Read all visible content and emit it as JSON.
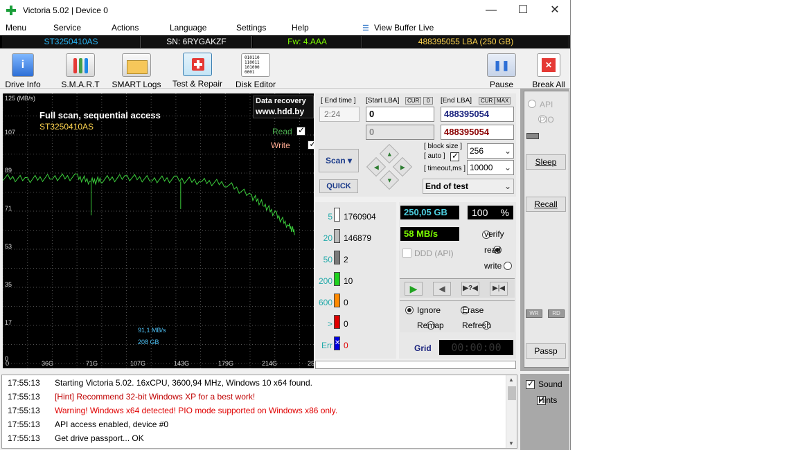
{
  "window": {
    "title": "Victoria 5.02 | Device 0",
    "min": "—",
    "max": "☐",
    "close": "✕"
  },
  "menu": [
    "Menu",
    "Service",
    "Actions",
    "Language",
    "Settings",
    "Help",
    "View Buffer Live"
  ],
  "infobar": {
    "model": "ST3250410AS",
    "serial": "SN: 6RYGAKZF",
    "firmware": "Fw: 4.AAA",
    "lba": "488395055 LBA (250 GB)"
  },
  "toolbar": {
    "drive_info": "Drive Info",
    "smart": "S.M.A.R.T",
    "smart_logs": "SMART Logs",
    "test_repair": "Test & Repair",
    "disk_editor": "Disk Editor",
    "pause": "Pause",
    "break_all": "Break All"
  },
  "graph": {
    "unit": "125 (MB/s)",
    "title": "Full scan, sequential access",
    "model": "ST3250410AS",
    "badge_line1": "Data recovery",
    "badge_line2": "www.hdd.by",
    "read_label": "Read",
    "write_label": "Write",
    "speed_readout": "91,1 MB/s",
    "pos_readout": "208 GB",
    "y_ticks": [
      "107",
      "89",
      "71",
      "53",
      "35",
      "17",
      "0"
    ],
    "x_ticks": [
      "36G",
      "71G",
      "107G",
      "143G",
      "179G",
      "214G",
      "25"
    ]
  },
  "chart_data": {
    "type": "line",
    "title": "Full scan, sequential access",
    "ylabel": "(MB/s)",
    "ylim": [
      0,
      125
    ],
    "x_label_ticks": [
      "0",
      "36G",
      "71G",
      "107G",
      "143G",
      "179G",
      "214G",
      "25"
    ],
    "series": [
      {
        "name": "Read",
        "x_gb": [
          0,
          20,
          40,
          60,
          71,
          80,
          100,
          120,
          140,
          160,
          180,
          200,
          210,
          220,
          230,
          235
        ],
        "values": [
          88,
          87,
          88,
          88,
          86,
          87,
          88,
          87,
          87,
          86,
          85,
          79,
          75,
          70,
          65,
          62
        ]
      }
    ]
  },
  "controls": {
    "end_time_label": "[ End time ]",
    "end_time": "2:24",
    "start_lba_label": "[Start LBA]",
    "cur": "CUR",
    "zero": "0",
    "end_lba_label": "[End LBA]",
    "max": "MAX",
    "start_lba": "0",
    "end_lba": "488395054",
    "start_lba2": "0",
    "end_lba2": "488395054",
    "scan": "Scan",
    "quick": "QUICK",
    "block_size_label": "[ block size ]",
    "auto_label": "[ auto ]",
    "block_size": "256",
    "timeout_label": "[ timeout,ms ]",
    "timeout": "10000",
    "end_action": "End of test"
  },
  "stats": [
    {
      "t": "5",
      "v": "1760904",
      "c": "#ffffff"
    },
    {
      "t": "20",
      "v": "146879",
      "c": "#bdbdbd"
    },
    {
      "t": "50",
      "v": "2",
      "c": "#7a7a7a"
    },
    {
      "t": "200",
      "v": "10",
      "c": "#1fd31f"
    },
    {
      "t": "600",
      "v": "0",
      "c": "#ff8a00"
    },
    {
      "t": ">",
      "v": "0",
      "c": "#e00000"
    },
    {
      "t": "Err",
      "v": "0",
      "c": "#0000e0"
    }
  ],
  "progress": {
    "size": "250,05 GB",
    "percent": "100",
    "pct_sign": "%",
    "speed": "58 MB/s",
    "ddd": "DDD (API)",
    "verify": "verify",
    "read": "read",
    "write": "write",
    "ignore": "Ignore",
    "erase": "Erase",
    "remap": "Remap",
    "refresh": "Refresh",
    "grid": "Grid",
    "timer": "00:00:00"
  },
  "side": {
    "api": "API",
    "pio": "PIO",
    "sleep": "Sleep",
    "recall": "Recall",
    "wr": "WR",
    "rd": "RD",
    "passp": "Passp",
    "sound": "Sound",
    "hints": "Hints"
  },
  "log": [
    {
      "ts": "17:55:13",
      "msg": "Starting Victoria 5.02. 16xCPU, 3600,94 MHz, Windows 10 x64 found.",
      "color": "#000000"
    },
    {
      "ts": "17:55:13",
      "msg": "[Hint] Recommend 32-bit Windows XP for a best work!",
      "color": "#c00000"
    },
    {
      "ts": "17:55:13",
      "msg": "Warning! Windows x64 detected! PIO mode supported on Windows x86 only.",
      "color": "#e00000"
    },
    {
      "ts": "17:55:13",
      "msg": "API access enabled, device #0",
      "color": "#000000"
    },
    {
      "ts": "17:55:13",
      "msg": "Get drive passport... OK",
      "color": "#000000"
    }
  ]
}
